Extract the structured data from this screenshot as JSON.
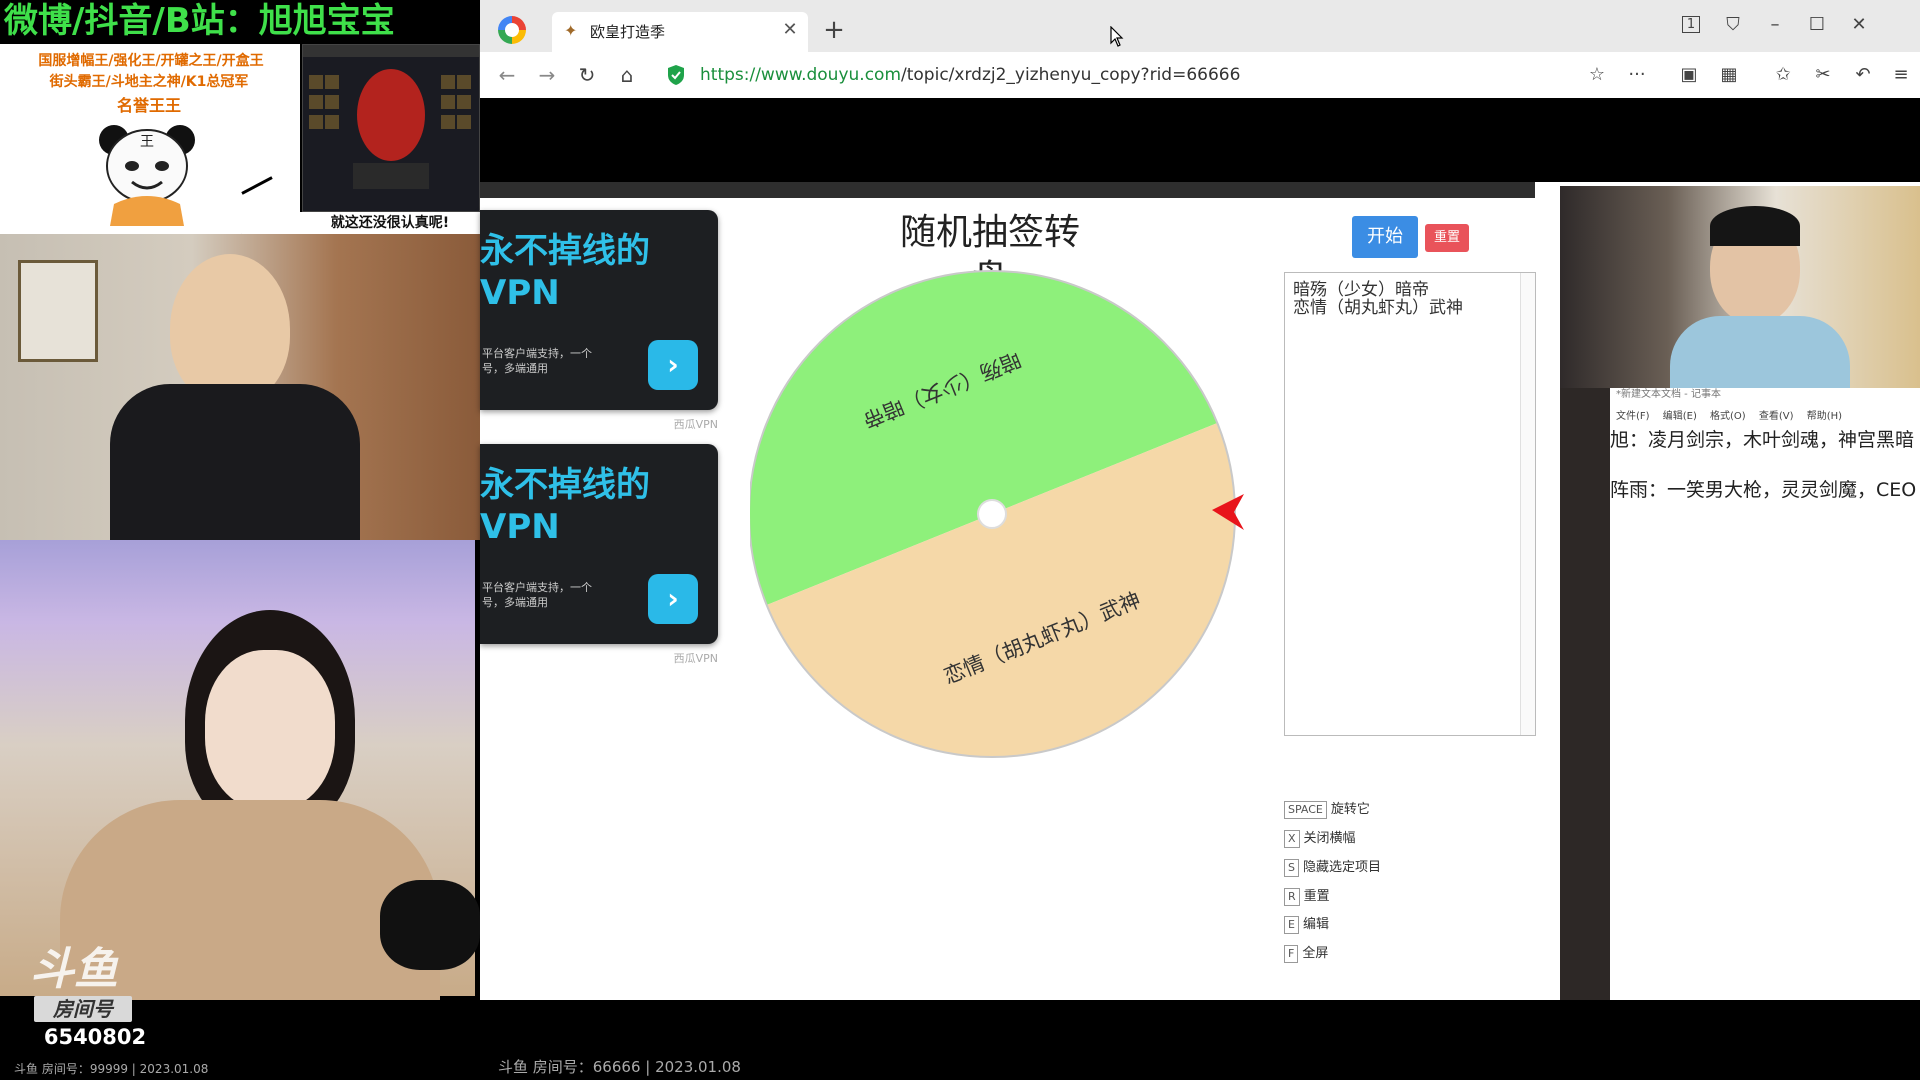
{
  "overlay": {
    "banner": "微博/抖音/B站：旭旭宝宝",
    "titles_line1": "国服增幅王/强化王/开罐之王/开盒王",
    "titles_line2": "街头霸王/斗地主之神/K1总冠军",
    "titles_line3": "名誉王王",
    "panda_badge": "王",
    "game_caption": "就这还没很认真呢!",
    "room_label": "房间号",
    "room_number": "6540802",
    "footer": "斗鱼 房间号：99999 | 2023.01.08",
    "logo": "斗鱼"
  },
  "browser": {
    "tab_title": "欧皇打造季",
    "url_host": "https://www.douyu.com",
    "url_path": "/topic/xrdzj2_yizhenyu_copy?rid=66666",
    "tab_count": "1"
  },
  "ads": [
    {
      "title_line1": "永不掉线的",
      "title_line2": "VPN",
      "desc_line1": "平台客户端支持，一个",
      "desc_line2": "号，多端通用",
      "tag": "西瓜VPN"
    },
    {
      "title_line1": "永不掉线的",
      "title_line2": "VPN",
      "desc_line1": "平台客户端支持，一个",
      "desc_line2": "号，多端通用",
      "tag": "西瓜VPN"
    }
  ],
  "wheel_app": {
    "title": "随机抽签转盘",
    "start_label": "开始",
    "reset_label": "重置",
    "list_items": [
      "暗殇（少女）暗帝",
      "恋情（胡丸虾丸）武神"
    ],
    "segments": [
      {
        "label": "暗殇（少女）暗帝",
        "color": "#8ef07b"
      },
      {
        "label": "恋情（胡丸虾丸）武神",
        "color": "#f5d8a8"
      }
    ],
    "pointer_color": "#e8141b",
    "shortcuts": [
      {
        "key": "SPACE",
        "label": "旋转它"
      },
      {
        "key": "X",
        "label": "关闭横幅"
      },
      {
        "key": "S",
        "label": "隐藏选定项目"
      },
      {
        "key": "R",
        "label": "重置"
      },
      {
        "key": "E",
        "label": "编辑"
      },
      {
        "key": "F",
        "label": "全屏"
      }
    ]
  },
  "notepad": {
    "title": "*新建文本文档 - 记事本",
    "menu": "文件(F) 编辑(E) 格式(O) 查看(V) 帮助(H)",
    "line1": "旭：凌月剑宗，木叶剑魂，神宫黑暗",
    "line2": "阵雨：一笑男大枪，灵灵剑魔，CEO"
  },
  "stream_footer": "斗鱼 房间号：66666 | 2023.01.08"
}
